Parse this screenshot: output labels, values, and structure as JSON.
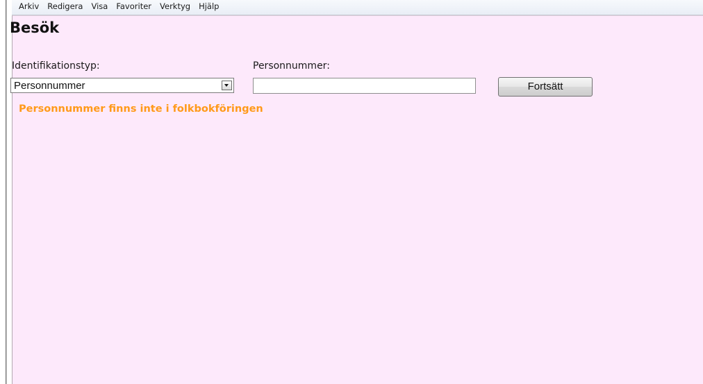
{
  "menubar": {
    "items": [
      "Arkiv",
      "Redigera",
      "Visa",
      "Favoriter",
      "Verktyg",
      "Hjälp"
    ]
  },
  "page": {
    "title": "Besök"
  },
  "form": {
    "id_type_label": "Identifikationstyp:",
    "id_type_value": "Personnummer",
    "pnr_label": "Personnummer:",
    "pnr_value": "",
    "continue_label": "Fortsätt"
  },
  "message": {
    "error": "Personnummer finns inte i folkbokföringen"
  },
  "colors": {
    "content_bg": "#fde9fb",
    "error_text": "#ff9a1a"
  }
}
